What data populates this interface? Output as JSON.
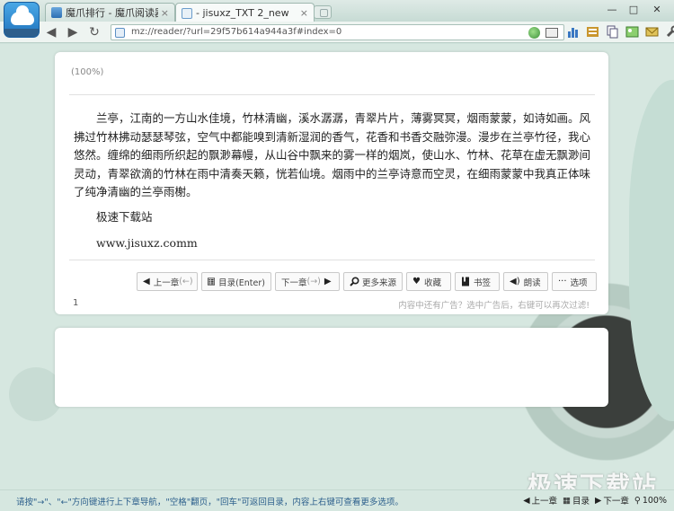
{
  "tabs": [
    {
      "title": "魔爪排行 - 魔爪阅读器",
      "close": "×"
    },
    {
      "title": "- jisuxz_TXT 2_new",
      "close": "×"
    }
  ],
  "window_controls": {
    "minimize": "—",
    "maximize": "□",
    "close": "✕"
  },
  "navigation": {
    "back": "◀",
    "forward": "▶",
    "refresh": "↻",
    "address": "mz://reader/?url=29f57b614a944a3f#index=0"
  },
  "reader": {
    "zoom": "(100%)",
    "paragraph": "兰亭，江南的一方山水佳境，竹林清幽，溪水潺潺，青翠片片，薄雾冥冥，烟雨蒙蒙，如诗如画。风拂过竹林拂动瑟瑟琴弦，空气中都能嗅到清新湿润的香气，花香和书香交融弥漫。漫步在兰亭竹径，我心悠然。缠绵的细雨所织起的飘渺幕幔，从山谷中飘来的雾一样的烟岚，使山水、竹林、花草在虚无飘渺间灵动，青翠欲滴的竹林在雨中清奏天籁，恍若仙境。烟雨中的兰亭诗意而空灵，在细雨蒙蒙中我真正体味了纯净清幽的兰亭雨榭。",
    "line2": "极速下载站",
    "line3": "www.jisuxz.comm",
    "buttons": {
      "prev": "上一章",
      "prev_key": "(←)",
      "toc": "目录(Enter)",
      "next": "下一章",
      "next_key": "(→)",
      "more_sources": "更多来源",
      "favorite": "收藏",
      "bookmark": "书签",
      "read_aloud": "朗读",
      "options": "选项"
    },
    "page_number": "1",
    "ad_tip": "内容中还有广告？选中广告后，右键可以再次过滤!"
  },
  "statusbar": {
    "hint": "请按\"→\"、\"←\"方向键进行上下章导航，\"空格\"翻页，\"回车\"可返回目录，内容上右键可查看更多选项。",
    "prev": "上一章",
    "toc": "目录",
    "next": "下一章",
    "zoom": "100%"
  },
  "watermark": "极速下载站",
  "colors": {
    "page_background": "#d6e7e0",
    "status_text": "#2c5f8c",
    "accent_blue": "#2d6fb3"
  },
  "icons": [
    "app-logo-icon",
    "back-icon",
    "forward-icon",
    "refresh-icon",
    "globe-icon",
    "reader-mode-icon",
    "chart-icon",
    "notes-icon",
    "copy-icon",
    "picture-icon",
    "mail-icon",
    "wrench-icon",
    "search-icon",
    "heart-icon",
    "bookmark-icon",
    "speaker-icon",
    "more-icon"
  ]
}
